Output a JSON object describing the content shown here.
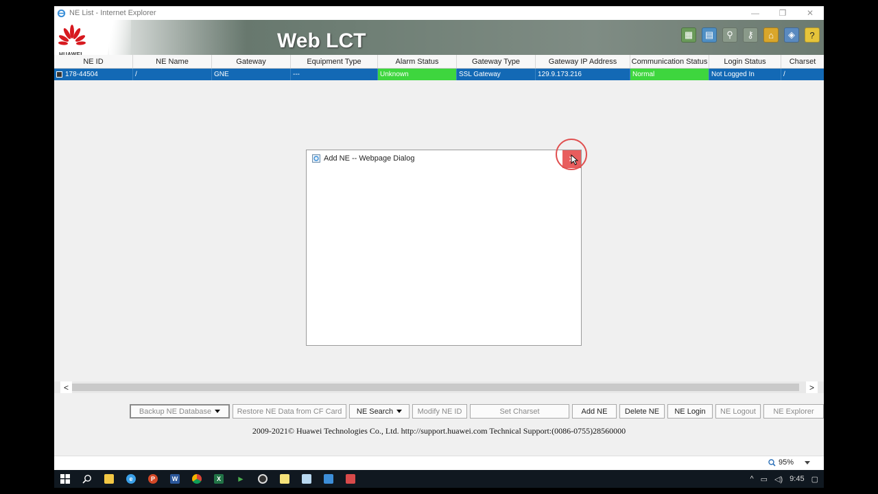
{
  "window": {
    "title": "NE List - Internet Explorer",
    "controls": {
      "minimize": "—",
      "restore": "❐",
      "close": "✕"
    }
  },
  "banner": {
    "brand": "HUAWEI",
    "app_title": "Web LCT",
    "icons": [
      "ne-list-icon",
      "book-icon",
      "search-key-icon",
      "key-icon",
      "home-icon",
      "layers-icon",
      "help-icon"
    ]
  },
  "table": {
    "columns": [
      "NE ID",
      "NE Name",
      "Gateway",
      "Equipment Type",
      "Alarm Status",
      "Gateway Type",
      "Gateway IP Address",
      "Communication Status",
      "Login Status",
      "Charset"
    ],
    "rows": [
      {
        "ne_id": "178-44504",
        "ne_name": "/",
        "gateway": "GNE",
        "equipment_type": "---",
        "alarm_status": "Unknown",
        "gateway_type": "SSL Gateway",
        "gateway_ip": "129.9.173.216",
        "communication_status": "Normal",
        "login_status": "Not Logged In",
        "charset": "/"
      }
    ]
  },
  "dialog": {
    "title": "Add NE -- Webpage Dialog"
  },
  "scrollbar": {
    "left_arrow": "<",
    "right_arrow": ">"
  },
  "buttons": {
    "backup": "Backup NE Database",
    "restore": "Restore NE Data from CF Card",
    "search": "NE Search",
    "modify": "Modify NE ID",
    "charset": "Set Charset",
    "add": "Add NE",
    "delete": "Delete NE",
    "login": "NE Login",
    "logout": "NE Logout",
    "explorer": "NE Explorer"
  },
  "footer": {
    "copyright": "2009-2021© Huawei Technologies Co., Ltd. http://support.huawei.com Technical Support:(0086-0755)28560000"
  },
  "statusbar": {
    "zoom": "95%"
  },
  "taskbar": {
    "clock": "9:45",
    "apps": [
      {
        "name": "start",
        "color": "#ffffff"
      },
      {
        "name": "search",
        "color": "#ffffff"
      },
      {
        "name": "file-explorer",
        "color": "#f2c744"
      },
      {
        "name": "internet-explorer",
        "color": "#3aa0e8"
      },
      {
        "name": "powerpoint",
        "color": "#d24726"
      },
      {
        "name": "word",
        "color": "#2b579a"
      },
      {
        "name": "chrome",
        "color": "#e8b03a"
      },
      {
        "name": "excel",
        "color": "#217346"
      },
      {
        "name": "media",
        "color": "#4caf50"
      },
      {
        "name": "recorder",
        "color": "#d0d0d0"
      },
      {
        "name": "notepad",
        "color": "#f5e27a"
      },
      {
        "name": "notes",
        "color": "#b8d8f0"
      },
      {
        "name": "app-blue",
        "color": "#3d8ed8"
      },
      {
        "name": "app-red",
        "color": "#d84a4a"
      }
    ]
  }
}
